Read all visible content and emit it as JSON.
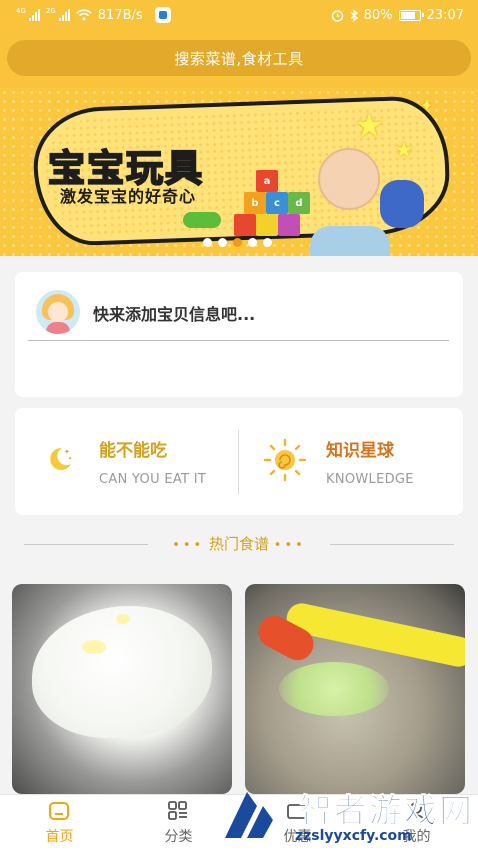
{
  "status_bar": {
    "network_speed": "817B/s",
    "battery": "80%",
    "time": "23:07"
  },
  "search": {
    "placeholder": "搜索菜谱,食材工具"
  },
  "banner": {
    "title": "宝宝玩具",
    "subtitle": "激发宝宝的好奇心",
    "block_letters": [
      "a",
      "b",
      "c",
      "d"
    ],
    "slide_count": 5,
    "active_slide": 3
  },
  "baby_card": {
    "prompt": "快来添加宝贝信息吧..."
  },
  "features": [
    {
      "title": "能不能吃",
      "subtitle": "CAN YOU EAT IT",
      "icon": "moon-stars-icon"
    },
    {
      "title": "知识星球",
      "subtitle": "KNOWLEDGE",
      "icon": "sun-icon"
    }
  ],
  "section": {
    "title": "热门食谱"
  },
  "bottom_nav": {
    "items": [
      {
        "label": "首页",
        "icon": "home-icon",
        "active": true
      },
      {
        "label": "分类",
        "icon": "category-grid-icon",
        "active": false
      },
      {
        "label": "优惠",
        "icon": "coupon-icon",
        "active": false
      },
      {
        "label": "我的",
        "icon": "profile-icon",
        "active": false
      }
    ]
  },
  "watermark": {
    "title": "智者游戏网",
    "url": "zzslyyxcfy.com"
  },
  "colors": {
    "brand_yellow": "#f9c43c",
    "accent_gold": "#d6a11d",
    "active_tab": "#f0a519"
  }
}
